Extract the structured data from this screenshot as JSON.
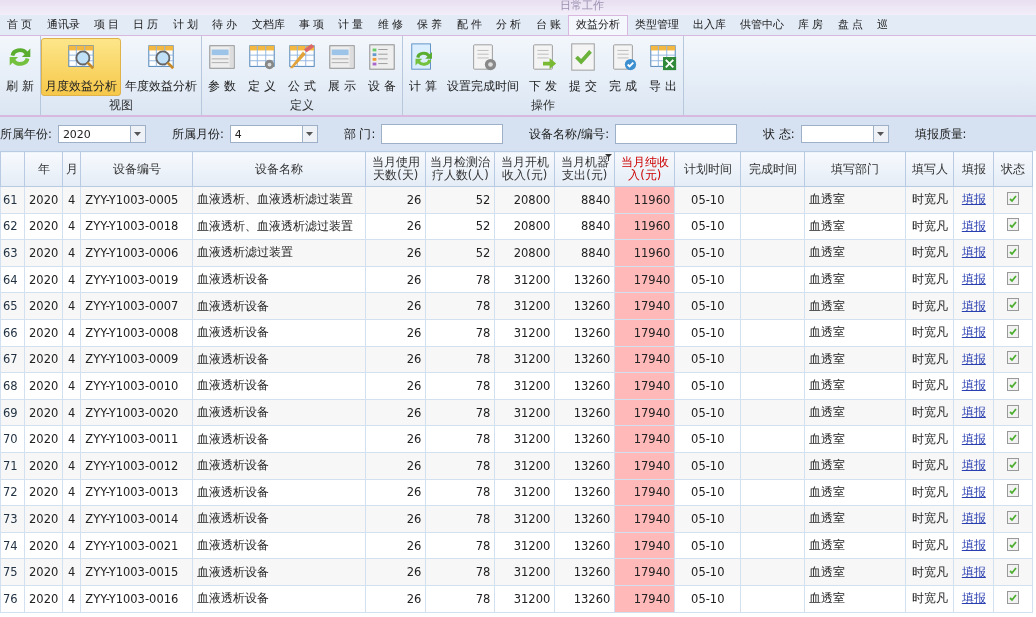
{
  "title_bar": {
    "group_title": "日常工作"
  },
  "tabs": [
    {
      "label": "首 页",
      "selected": false
    },
    {
      "label": "通讯录",
      "selected": false
    },
    {
      "label": "项 目",
      "selected": false
    },
    {
      "label": "日 历",
      "selected": false
    },
    {
      "label": "计 划",
      "selected": false
    },
    {
      "label": "待 办",
      "selected": false
    },
    {
      "label": "文档库",
      "selected": false
    },
    {
      "label": "事 项",
      "selected": false
    },
    {
      "label": "计 量",
      "selected": false
    },
    {
      "label": "维 修",
      "selected": false
    },
    {
      "label": "保 养",
      "selected": false
    },
    {
      "label": "配 件",
      "selected": false
    },
    {
      "label": "分 析",
      "selected": false
    },
    {
      "label": "台 账",
      "selected": false
    },
    {
      "label": "效益分析",
      "selected": true
    },
    {
      "label": "类型管理",
      "selected": false
    },
    {
      "label": "出入库",
      "selected": false
    },
    {
      "label": "供管中心",
      "selected": false
    },
    {
      "label": "库 房",
      "selected": false
    },
    {
      "label": "盘 点",
      "selected": false
    },
    {
      "label": "巡",
      "selected": false
    }
  ],
  "ribbon": [
    {
      "buttons": [
        {
          "label": "刷 新",
          "selected": false
        }
      ]
    },
    {
      "label": "视图",
      "buttons": [
        {
          "label": "月度效益分析",
          "selected": true
        },
        {
          "label": "年度效益分析",
          "selected": false
        }
      ]
    },
    {
      "label": "定义",
      "buttons": [
        {
          "label": "参 数",
          "selected": false
        },
        {
          "label": "定 义",
          "selected": false
        },
        {
          "label": "公 式",
          "selected": false
        },
        {
          "label": "展 示",
          "selected": false
        },
        {
          "label": "设 备",
          "selected": false
        }
      ]
    },
    {
      "label": "操作",
      "buttons": [
        {
          "label": "计 算",
          "selected": false
        },
        {
          "label": "设置完成时间",
          "selected": false
        },
        {
          "label": "下 发",
          "selected": false
        },
        {
          "label": "提 交",
          "selected": false
        },
        {
          "label": "完 成",
          "selected": false
        },
        {
          "label": "导 出",
          "selected": false
        }
      ]
    }
  ],
  "filters": [
    {
      "label": "所属年份:",
      "value": "2020",
      "kind": "dropdown"
    },
    {
      "label": "所属月份:",
      "value": "4",
      "kind": "dropdown"
    },
    {
      "label": "部 门:",
      "kind": "text"
    },
    {
      "label": "设备名称/编号:",
      "kind": "text"
    },
    {
      "label": "状 态:",
      "kind": "dropdown"
    },
    {
      "label": "填报质量:",
      "kind": "label"
    }
  ],
  "table": {
    "columns": [
      {},
      {
        "label": "年"
      },
      {
        "label": "月"
      },
      {
        "label": "设备编号"
      },
      {
        "label": "设备名称"
      },
      {
        "label": "当月使用天数(天)"
      },
      {
        "label": "当月检测治疗人数(人)"
      },
      {
        "label": "当月开机收入(元)"
      },
      {
        "label": "当月机器支出(元)",
        "filtered": true
      },
      {
        "label": "当月纯收入(元)",
        "highlighted": true
      },
      {
        "label": "计划时间"
      },
      {
        "label": "完成时间"
      },
      {
        "label": "填写部门"
      },
      {
        "label": "填写人"
      },
      {
        "label": "填报"
      },
      {
        "label": "状态"
      }
    ],
    "rows": [
      [
        "61",
        "2020",
        "4",
        "ZYY-Y1003-0005",
        "血液透析、血液透析滤过装置",
        "26",
        "52",
        "20800",
        "8840",
        "11960",
        "05-10",
        "",
        "血透室",
        "时宽凡",
        "填报"
      ],
      [
        "62",
        "2020",
        "4",
        "ZYY-Y1003-0018",
        "血液透析、血液透析滤过装置",
        "26",
        "52",
        "20800",
        "8840",
        "11960",
        "05-10",
        "",
        "血透室",
        "时宽凡",
        "填报"
      ],
      [
        "63",
        "2020",
        "4",
        "ZYY-Y1003-0006",
        "血液透析滤过装置",
        "26",
        "52",
        "20800",
        "8840",
        "11960",
        "05-10",
        "",
        "血透室",
        "时宽凡",
        "填报"
      ],
      [
        "64",
        "2020",
        "4",
        "ZYY-Y1003-0019",
        "血液透析设备",
        "26",
        "78",
        "31200",
        "13260",
        "17940",
        "05-10",
        "",
        "血透室",
        "时宽凡",
        "填报"
      ],
      [
        "65",
        "2020",
        "4",
        "ZYY-Y1003-0007",
        "血液透析设备",
        "26",
        "78",
        "31200",
        "13260",
        "17940",
        "05-10",
        "",
        "血透室",
        "时宽凡",
        "填报"
      ],
      [
        "66",
        "2020",
        "4",
        "ZYY-Y1003-0008",
        "血液透析设备",
        "26",
        "78",
        "31200",
        "13260",
        "17940",
        "05-10",
        "",
        "血透室",
        "时宽凡",
        "填报"
      ],
      [
        "67",
        "2020",
        "4",
        "ZYY-Y1003-0009",
        "血液透析设备",
        "26",
        "78",
        "31200",
        "13260",
        "17940",
        "05-10",
        "",
        "血透室",
        "时宽凡",
        "填报"
      ],
      [
        "68",
        "2020",
        "4",
        "ZYY-Y1003-0010",
        "血液透析设备",
        "26",
        "78",
        "31200",
        "13260",
        "17940",
        "05-10",
        "",
        "血透室",
        "时宽凡",
        "填报"
      ],
      [
        "69",
        "2020",
        "4",
        "ZYY-Y1003-0020",
        "血液透析设备",
        "26",
        "78",
        "31200",
        "13260",
        "17940",
        "05-10",
        "",
        "血透室",
        "时宽凡",
        "填报"
      ],
      [
        "70",
        "2020",
        "4",
        "ZYY-Y1003-0011",
        "血液透析设备",
        "26",
        "78",
        "31200",
        "13260",
        "17940",
        "05-10",
        "",
        "血透室",
        "时宽凡",
        "填报"
      ],
      [
        "71",
        "2020",
        "4",
        "ZYY-Y1003-0012",
        "血液透析设备",
        "26",
        "78",
        "31200",
        "13260",
        "17940",
        "05-10",
        "",
        "血透室",
        "时宽凡",
        "填报"
      ],
      [
        "72",
        "2020",
        "4",
        "ZYY-Y1003-0013",
        "血液透析设备",
        "26",
        "78",
        "31200",
        "13260",
        "17940",
        "05-10",
        "",
        "血透室",
        "时宽凡",
        "填报"
      ],
      [
        "73",
        "2020",
        "4",
        "ZYY-Y1003-0014",
        "血液透析设备",
        "26",
        "78",
        "31200",
        "13260",
        "17940",
        "05-10",
        "",
        "血透室",
        "时宽凡",
        "填报"
      ],
      [
        "74",
        "2020",
        "4",
        "ZYY-Y1003-0021",
        "血液透析设备",
        "26",
        "78",
        "31200",
        "13260",
        "17940",
        "05-10",
        "",
        "血透室",
        "时宽凡",
        "填报"
      ],
      [
        "75",
        "2020",
        "4",
        "ZYY-Y1003-0015",
        "血液透析设备",
        "26",
        "78",
        "31200",
        "13260",
        "17940",
        "05-10",
        "",
        "血透室",
        "时宽凡",
        "填报"
      ],
      [
        "76",
        "2020",
        "4",
        "ZYY-Y1003-0016",
        "血液透析设备",
        "26",
        "78",
        "31200",
        "13260",
        "17940",
        "05-10",
        "",
        "血透室",
        "时宽凡",
        "填报"
      ]
    ]
  }
}
